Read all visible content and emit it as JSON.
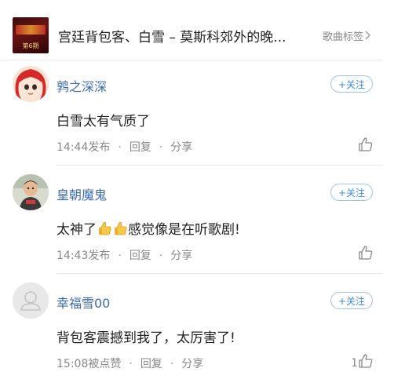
{
  "song": {
    "title": "宫廷背包客、白雪 – 莫斯科郊外的晚...",
    "tag_label": "歌曲标签",
    "cover_text": "第6期"
  },
  "comments": [
    {
      "username": "鹑之深深",
      "follow_label": "+关注",
      "text": "白雪太有气质了",
      "time": "14:44发布",
      "reply": "回复",
      "share": "分享",
      "likes": ""
    },
    {
      "username": "皇朝魔鬼",
      "follow_label": "+关注",
      "text_before": "太神了",
      "text_after": "感觉像是在听歌剧!",
      "time": "14:43发布",
      "reply": "回复",
      "share": "分享",
      "likes": ""
    },
    {
      "username": "幸福雪00",
      "follow_label": "+关注",
      "text": "背包客震撼到我了，太厉害了!",
      "time": "15:08被点赞",
      "reply": "回复",
      "share": "分享",
      "likes": "1"
    }
  ],
  "colors": {
    "username": "#3c6bb5",
    "follow": "#3c8be0",
    "meta": "#888888"
  }
}
